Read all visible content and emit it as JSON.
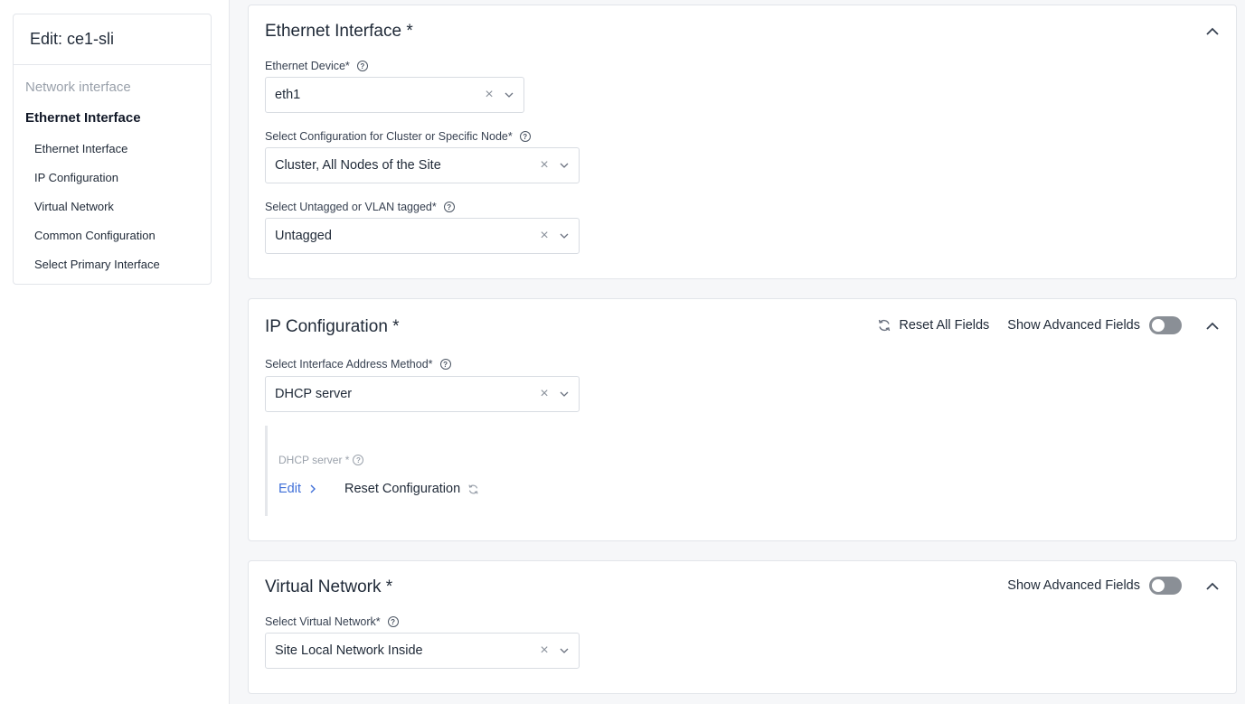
{
  "sidebar": {
    "title": "Edit: ce1-sli",
    "section_label": "Network interface",
    "group_label": "Ethernet Interface",
    "items": [
      {
        "label": "Ethernet Interface"
      },
      {
        "label": "IP Configuration"
      },
      {
        "label": "Virtual Network"
      },
      {
        "label": "Common Configuration"
      },
      {
        "label": "Select Primary Interface"
      }
    ]
  },
  "ethernet_card": {
    "title": "Ethernet Interface *",
    "device": {
      "label": "Ethernet Device*",
      "value": "eth1"
    },
    "config": {
      "label": "Select Configuration for Cluster or Specific Node*",
      "value": "Cluster, All Nodes of the Site"
    },
    "vlan": {
      "label": "Select Untagged or VLAN tagged*",
      "value": "Untagged"
    }
  },
  "ip_card": {
    "title": "IP Configuration *",
    "reset_all_label": "Reset All Fields",
    "show_advanced_label": "Show Advanced Fields",
    "show_advanced_enabled": false,
    "address_method": {
      "label": "Select Interface Address Method*",
      "value": "DHCP server"
    },
    "dhcp": {
      "label": "DHCP server *",
      "edit_label": "Edit",
      "reset_label": "Reset Configuration"
    }
  },
  "vn_card": {
    "title": "Virtual Network *",
    "show_advanced_label": "Show Advanced Fields",
    "show_advanced_enabled": false,
    "virtual_network": {
      "label": "Select Virtual Network*",
      "value": "Site Local Network Inside"
    }
  },
  "icons": {
    "clear": "×",
    "help": "?"
  },
  "colors": {
    "link": "#3f6fd8",
    "toggle_off": "#8a8f96",
    "page_bg": "#f6f7f9"
  }
}
